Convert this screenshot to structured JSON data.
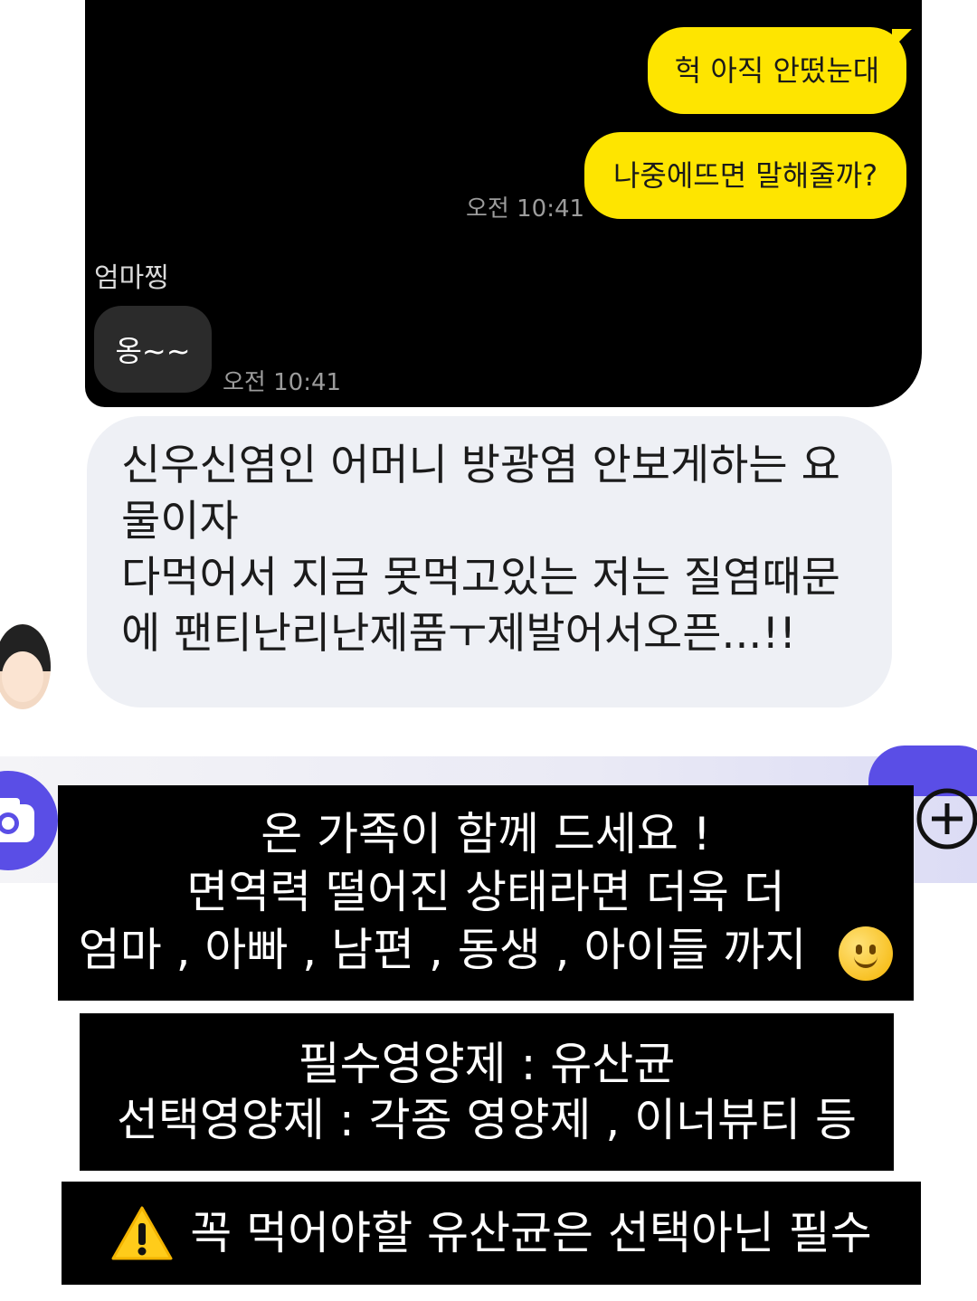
{
  "chat": {
    "my_messages": [
      "헉 아직 안떴눈대",
      "나중에뜨면 말해줄까?"
    ],
    "my_time": "오전 10:41",
    "sender_name": "엄마찡",
    "their_message": "옹~~",
    "their_time": "오전 10:41"
  },
  "comment": {
    "text": "신우신염인 어머니 방광염 안보게하는 요\n물이자\n다먹어서 지금 못먹고있는 저는 질염때문\n에 팬티난리난제품ㅜ제발어서오픈...!!"
  },
  "overlay": {
    "box1": [
      "온 가족이 함께 드세요 !",
      "면역력 떨어진 상태라면 더욱 더",
      "엄마 , 아빠 , 남편 , 동생 , 아이들 까지"
    ],
    "box2": [
      "필수영양제 : 유산균",
      "선택영양제 : 각종 영양제 , 이너뷰티 등"
    ],
    "box3": "꼭 먹어야할 유산균은 선택아닌 필수"
  },
  "colors": {
    "my_bubble": "#fee500",
    "their_bubble": "#2b2b2b",
    "accent": "#5a4ee6",
    "comment_bg": "#eef0f5"
  },
  "icons": [
    "camera-icon",
    "plus-circle-icon",
    "smiley-emoji-icon",
    "warning-icon"
  ]
}
